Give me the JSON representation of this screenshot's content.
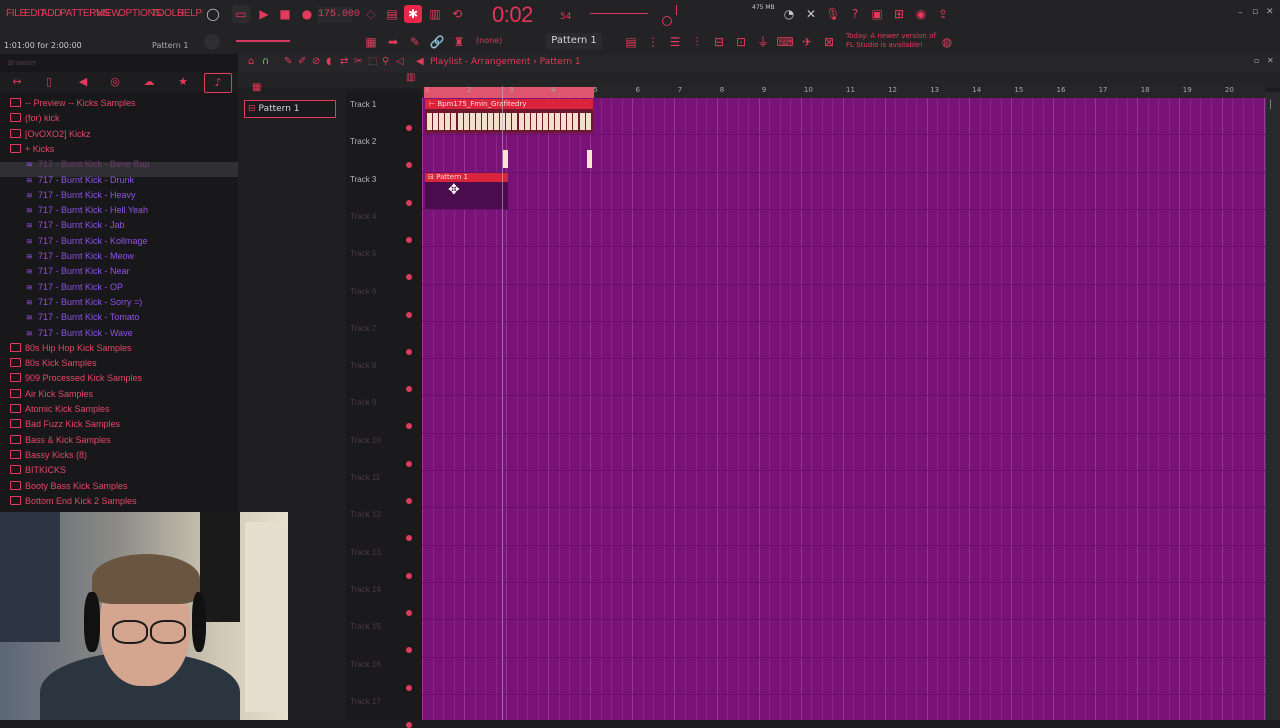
{
  "menu": [
    "FILE",
    "EDIT",
    "ADD",
    "PATTERNS",
    "VIEW",
    "OPTIONS",
    "TOOLS",
    "HELP"
  ],
  "tempo": "175.000",
  "time": "0:02",
  "time_sub": "54",
  "hint": "1:01:00 for 2:00:00",
  "pattern_top": "Pattern 1",
  "pattern_selector": "Pattern 1",
  "none_selector": "(none)",
  "news": "Today: A newer version of FL Studio is available!",
  "memory": "475 MB",
  "browser": {
    "label": "Browser",
    "items": [
      {
        "type": "folder",
        "label": "-- Preview -- Kicks Samples"
      },
      {
        "type": "folder",
        "label": "(for) kick"
      },
      {
        "type": "folder",
        "label": "[OvOXO2] Kickz"
      },
      {
        "type": "folder",
        "label": "+ Kicks"
      },
      {
        "type": "sample",
        "label": "717 - Burnt Kick - Bene Bap"
      },
      {
        "type": "sample",
        "label": "717 - Burnt Kick - Drunk"
      },
      {
        "type": "sample",
        "label": "717 - Burnt Kick - Heavy"
      },
      {
        "type": "sample",
        "label": "717 - Burnt Kick - Hell Yeah"
      },
      {
        "type": "sample",
        "label": "717 - Burnt Kick - Jab"
      },
      {
        "type": "sample",
        "label": "717 - Burnt Kick - Kollmage"
      },
      {
        "type": "sample",
        "label": "717 - Burnt Kick - Meow"
      },
      {
        "type": "sample",
        "label": "717 - Burnt Kick - Near"
      },
      {
        "type": "sample",
        "label": "717 - Burnt Kick - OP"
      },
      {
        "type": "sample",
        "label": "717 - Burnt Kick - Sorry =)"
      },
      {
        "type": "sample",
        "label": "717 - Burnt Kick - Tomato"
      },
      {
        "type": "sample",
        "label": "717 - Burnt Kick - Wave"
      },
      {
        "type": "folder",
        "label": "80s Hip Hop Kick Samples"
      },
      {
        "type": "folder",
        "label": "80s Kick Samples"
      },
      {
        "type": "folder",
        "label": "909 Processed Kick Samples"
      },
      {
        "type": "folder",
        "label": "Air Kick Samples"
      },
      {
        "type": "folder",
        "label": "Atomic Kick Samples"
      },
      {
        "type": "folder",
        "label": "Bad Fuzz Kick Samples"
      },
      {
        "type": "folder",
        "label": "Bass & Kick Samples"
      },
      {
        "type": "folder",
        "label": "Bassy Kicks (8)"
      },
      {
        "type": "folder",
        "label": "BITKICKS"
      },
      {
        "type": "folder",
        "label": "Booty Bass Kick Samples"
      },
      {
        "type": "folder",
        "label": "Bottom End Kick 2 Samples"
      }
    ]
  },
  "pattern_list": {
    "item": "Pattern 1"
  },
  "playlist": {
    "title": "Playlist - Arrangement › Pattern 1",
    "ruler": [
      "1",
      "2",
      "3",
      "4",
      "5",
      "6",
      "7",
      "8",
      "9",
      "10",
      "11",
      "12",
      "13",
      "14",
      "15",
      "16",
      "17",
      "18",
      "19",
      "20"
    ],
    "tracks": [
      "Track 1",
      "Track 2",
      "Track 3",
      "Track 4",
      "Track 5",
      "Track 6",
      "Track 7",
      "Track 8",
      "Track 9",
      "Track 10",
      "Track 11",
      "Track 12",
      "Track 13",
      "Track 14",
      "Track 15",
      "Track 16",
      "Track 17"
    ],
    "clip_audio": "Bpm175_Fmin_Grafitedry",
    "clip_pattern": "Pattern 1"
  },
  "colors": {
    "accent": "#e23a5a",
    "grid": "#7a1378",
    "sample_text": "#8f52e2"
  }
}
